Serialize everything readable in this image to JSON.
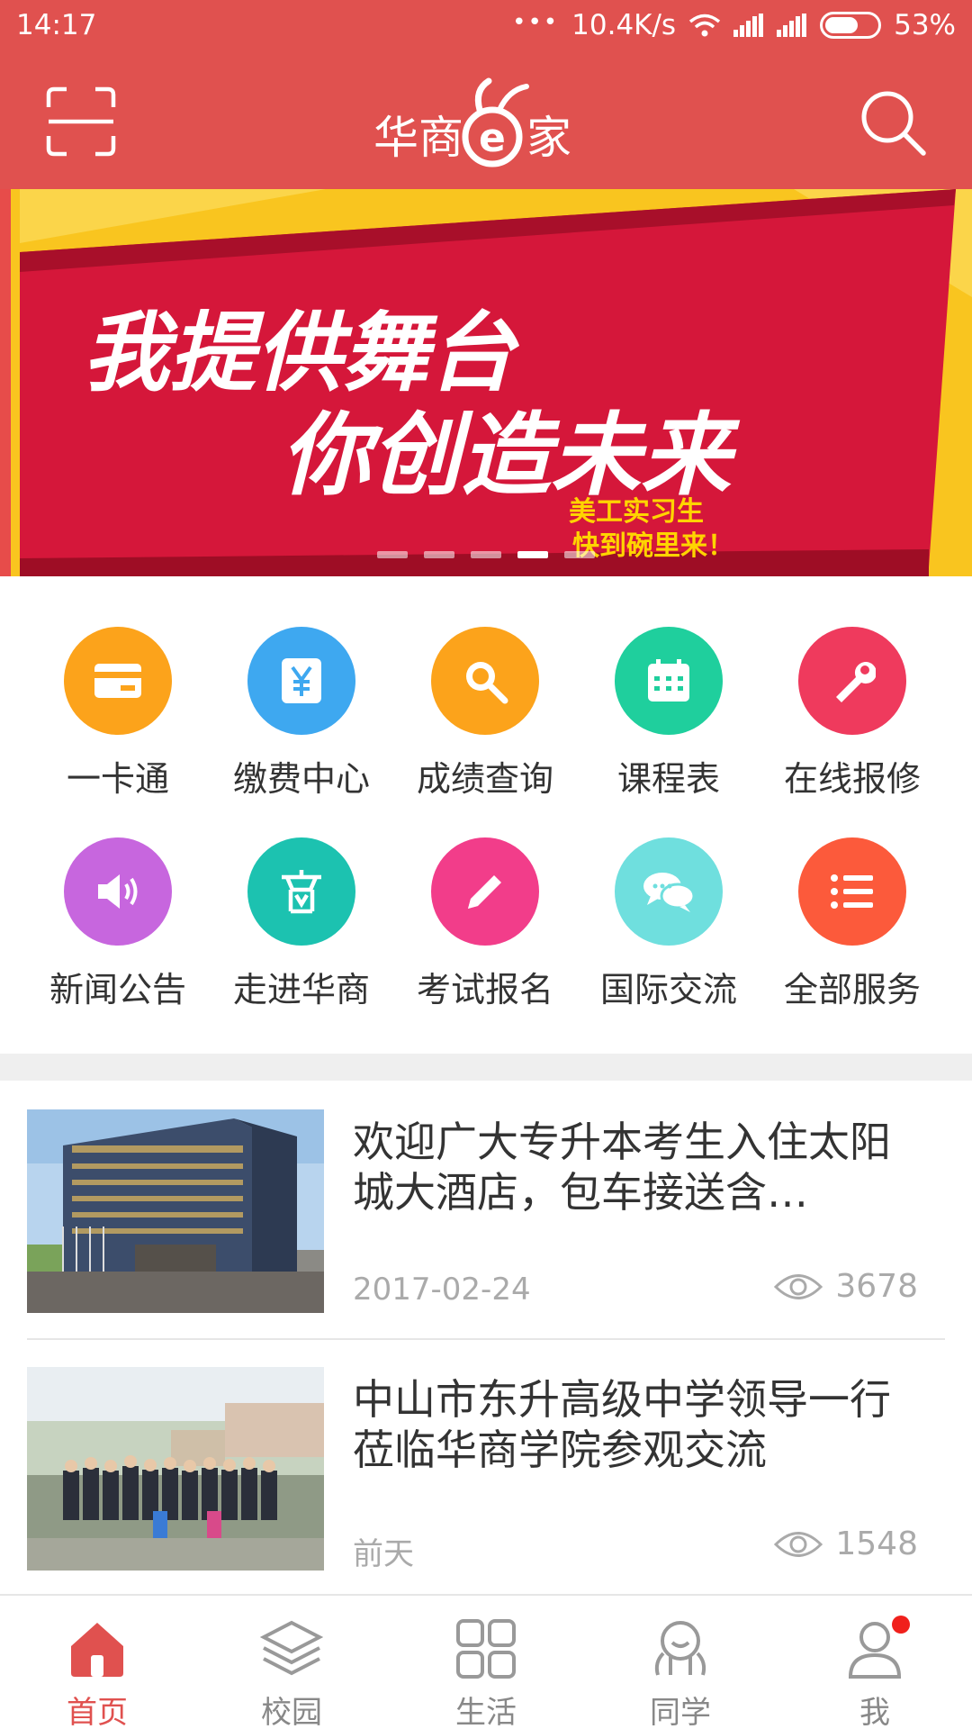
{
  "status_bar": {
    "time": "14:17",
    "network_speed": "10.4K/s",
    "battery": "53%"
  },
  "header": {
    "brand": "华商e家",
    "brand_left": "华商",
    "brand_e": "e",
    "brand_right": "家",
    "scan_icon": "scan-icon",
    "search_icon": "search-icon"
  },
  "banner": {
    "line1": "我提供舞台",
    "line2": "你创造未来",
    "sub1": "美工实习生",
    "sub2": "快到碗里来！",
    "slide_count": 5,
    "active_slide": 4
  },
  "services": [
    {
      "label": "一卡通",
      "icon": "card-icon",
      "color": "#fca31b"
    },
    {
      "label": "缴费中心",
      "icon": "yen-icon",
      "color": "#3ea8f0"
    },
    {
      "label": "成绩查询",
      "icon": "magnifier-icon",
      "color": "#fca31b"
    },
    {
      "label": "课程表",
      "icon": "calendar-icon",
      "color": "#1fcf9d"
    },
    {
      "label": "在线报修",
      "icon": "wrench-icon",
      "color": "#ef3a5d"
    },
    {
      "label": "新闻公告",
      "icon": "speaker-icon",
      "color": "#c766de"
    },
    {
      "label": "走进华商",
      "icon": "building-icon",
      "color": "#1cc2b0"
    },
    {
      "label": "考试报名",
      "icon": "pencil-icon",
      "color": "#f23d8a"
    },
    {
      "label": "国际交流",
      "icon": "chat-icon",
      "color": "#6fdfde"
    },
    {
      "label": "全部服务",
      "icon": "list-icon",
      "color": "#fc5a3b"
    }
  ],
  "news": [
    {
      "title": "欢迎广大专升本考生入住太阳城大酒店，包车接送含…",
      "date": "2017-02-24",
      "views": "3678"
    },
    {
      "title": "中山市东升高级中学领导一行莅临华商学院参观交流",
      "date": "前天",
      "views": "1548"
    }
  ],
  "nav": [
    {
      "label": "首页",
      "icon": "home-icon",
      "active": true
    },
    {
      "label": "校园",
      "icon": "layers-icon",
      "active": false
    },
    {
      "label": "生活",
      "icon": "grid-icon",
      "active": false
    },
    {
      "label": "同学",
      "icon": "classmate-icon",
      "active": false
    },
    {
      "label": "我",
      "icon": "user-icon",
      "active": false
    }
  ],
  "colors": {
    "brand": "#e0514f",
    "banner_red": "#d5173a",
    "banner_yellow": "#f9c51f"
  }
}
